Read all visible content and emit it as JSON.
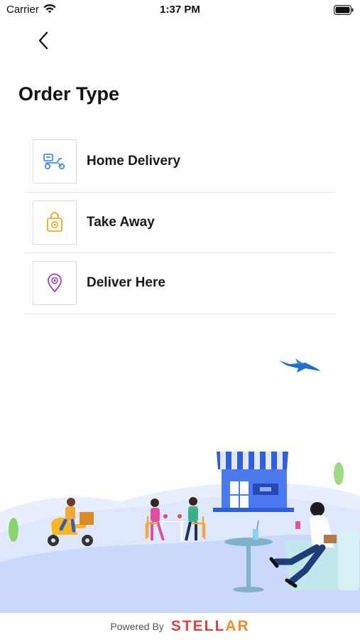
{
  "status_bar": {
    "carrier": "Carrier",
    "time": "1:37 PM"
  },
  "header": {
    "title": "Order Type"
  },
  "options": [
    {
      "label": "Home Delivery",
      "icon": "scooter-icon",
      "icon_color": "#3d8ff2"
    },
    {
      "label": "Take Away",
      "icon": "shopping-bag-icon",
      "icon_color": "#f5a623"
    },
    {
      "label": "Deliver Here",
      "icon": "location-pin-icon",
      "icon_color": "#9c3fb8"
    }
  ],
  "footer": {
    "powered_by": "Powered By",
    "brand_main": "STELL",
    "brand_accent": "AR",
    "brand_color": "#e0413f",
    "brand_accent_color": "#f28a2f"
  }
}
